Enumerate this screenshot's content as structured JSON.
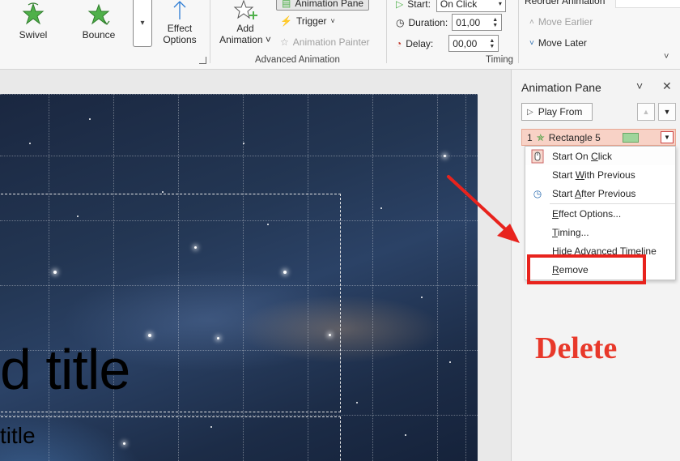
{
  "ribbon": {
    "animations": [
      {
        "label": "Swivel",
        "icon": "swivel-star-icon"
      },
      {
        "label": "Bounce",
        "icon": "bounce-star-icon"
      }
    ],
    "effect_options": {
      "line1": "Effect",
      "line2": "Options"
    },
    "add_animation": {
      "line1": "Add",
      "line2": "Animation"
    },
    "animation_pane_btn": "Animation Pane",
    "trigger": "Trigger",
    "animation_painter": "Animation Painter",
    "advanced_group_label": "Advanced Animation",
    "timing": {
      "start_label": "Start:",
      "start_value": "On Click",
      "duration_label": "Duration:",
      "duration_value": "01,00",
      "delay_label": "Delay:",
      "delay_value": "00,00",
      "group_label": "Timing"
    },
    "reorder": {
      "header": "Reorder Animation",
      "earlier": "Move Earlier",
      "later": "Move Later"
    }
  },
  "slide": {
    "title_text": "d title",
    "subtitle_text": "title"
  },
  "pane": {
    "title": "Animation Pane",
    "play_from": "Play From",
    "item": {
      "number": "1",
      "name": "Rectangle 5",
      "swatch_color": "#9fd59b"
    }
  },
  "menu": {
    "start_on_click": {
      "pre": "Start On ",
      "u": "C",
      "post": "lick"
    },
    "start_with_previous": {
      "pre": "Start ",
      "u": "W",
      "post": "ith Previous"
    },
    "start_after_previous": {
      "pre": "Start ",
      "u": "A",
      "post": "fter Previous"
    },
    "effect_options": {
      "pre": "",
      "u": "E",
      "post": "ffect Options..."
    },
    "timing": {
      "pre": "",
      "u": "T",
      "post": "iming..."
    },
    "hide_timeline": {
      "pre": "",
      "u": "H",
      "post": "ide Advanced Timeline"
    },
    "remove": {
      "pre": "",
      "u": "R",
      "post": "emove"
    }
  },
  "annotation": {
    "note": "Delete",
    "color": "#e8231d"
  }
}
